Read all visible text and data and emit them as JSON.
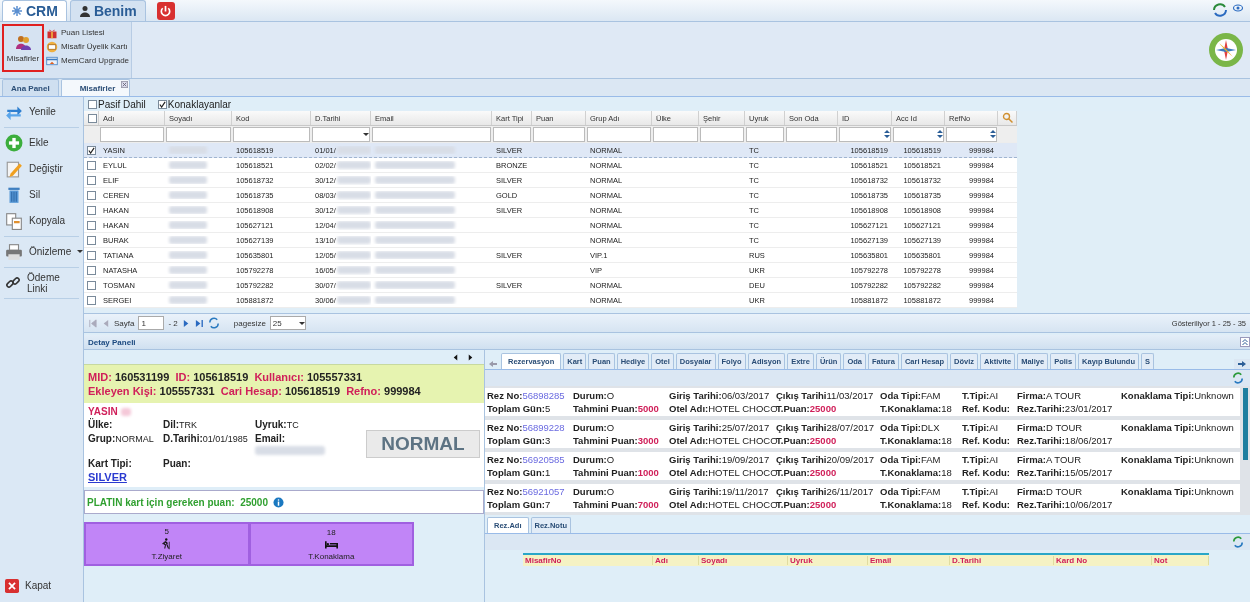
{
  "top_tabs": [
    {
      "label": "CRM",
      "selected": true
    },
    {
      "label": "Benim",
      "selected": false
    }
  ],
  "ribbon": {
    "main": {
      "label": "Misafirler",
      "selected": true
    },
    "items": [
      "Puan Listesi",
      "Misafir Üyelik Kartı",
      "MemCard Upgrade"
    ]
  },
  "doc_tabs": [
    {
      "label": "Ana Panel",
      "selected": false,
      "closable": false
    },
    {
      "label": "Misafirler",
      "selected": true,
      "closable": true
    }
  ],
  "sidebar": {
    "items": [
      {
        "label": "Yenile",
        "has_menu": false
      },
      {
        "label": "Ekle",
        "has_menu": false
      },
      {
        "label": "Değiştir",
        "has_menu": false
      },
      {
        "label": "Sil",
        "has_menu": false
      },
      {
        "label": "Kopyala",
        "has_menu": false
      },
      {
        "label": "Önizleme",
        "has_menu": true
      },
      {
        "label": "Ödeme Linki",
        "has_menu": false
      }
    ],
    "footer": "Kapat"
  },
  "filters": [
    {
      "label": "Pasif Dahil",
      "checked": false
    },
    {
      "label": "Konaklayanlar",
      "checked": true
    }
  ],
  "grid": {
    "all_selected": false,
    "columns": [
      {
        "label": "Adı",
        "kind": "text",
        "redacted": false
      },
      {
        "label": "Soyadı",
        "kind": "text",
        "redacted": true
      },
      {
        "label": "Kod",
        "kind": "text",
        "redacted": false
      },
      {
        "label": "D.Tarihi",
        "kind": "date",
        "redacted": true
      },
      {
        "label": "Email",
        "kind": "text",
        "redacted": true
      },
      {
        "label": "Kart Tipi",
        "kind": "text",
        "redacted": false
      },
      {
        "label": "Puan",
        "kind": "text",
        "redacted": false
      },
      {
        "label": "Grup Adı",
        "kind": "text",
        "redacted": false
      },
      {
        "label": "Ülke",
        "kind": "text",
        "redacted": false
      },
      {
        "label": "Şehir",
        "kind": "text",
        "redacted": false
      },
      {
        "label": "Uyruk",
        "kind": "text",
        "redacted": false
      },
      {
        "label": "Son Oda",
        "kind": "text",
        "redacted": false
      },
      {
        "label": "ID",
        "kind": "number",
        "redacted": false
      },
      {
        "label": "Acc Id",
        "kind": "number",
        "redacted": false
      },
      {
        "label": "RefNo",
        "kind": "number",
        "redacted": false
      }
    ],
    "rows": [
      {
        "selected": true,
        "name": "YASIN",
        "code": "105618519",
        "birth": "01/01/",
        "card": "SILVER",
        "group": "NORMAL",
        "nationality": "TC",
        "id": "105618519",
        "acc_id": "105618519",
        "ref_no": "999984"
      },
      {
        "selected": false,
        "name": "EYLUL",
        "code": "105618521",
        "birth": "02/02/",
        "card": "BRONZE",
        "group": "NORMAL",
        "nationality": "TC",
        "id": "105618521",
        "acc_id": "105618521",
        "ref_no": "999984"
      },
      {
        "selected": false,
        "name": "ELIF",
        "code": "105618732",
        "birth": "30/12/",
        "card": "SILVER",
        "group": "NORMAL",
        "nationality": "TC",
        "id": "105618732",
        "acc_id": "105618732",
        "ref_no": "999984"
      },
      {
        "selected": false,
        "name": "CEREN",
        "code": "105618735",
        "birth": "08/03/",
        "card": "GOLD",
        "group": "NORMAL",
        "nationality": "TC",
        "id": "105618735",
        "acc_id": "105618735",
        "ref_no": "999984"
      },
      {
        "selected": false,
        "name": "HAKAN",
        "code": "105618908",
        "birth": "30/12/",
        "card": "SILVER",
        "group": "NORMAL",
        "nationality": "TC",
        "id": "105618908",
        "acc_id": "105618908",
        "ref_no": "999984"
      },
      {
        "selected": false,
        "name": "HAKAN",
        "code": "105627121",
        "birth": "12/04/",
        "group": "NORMAL",
        "nationality": "TC",
        "id": "105627121",
        "acc_id": "105627121",
        "ref_no": "999984"
      },
      {
        "selected": false,
        "name": "BURAK",
        "code": "105627139",
        "birth": "13/10/",
        "group": "NORMAL",
        "nationality": "TC",
        "id": "105627139",
        "acc_id": "105627139",
        "ref_no": "999984"
      },
      {
        "selected": false,
        "name": "TATIANA",
        "code": "105635801",
        "birth": "12/05/",
        "card": "SILVER",
        "group": "VIP.1",
        "nationality": "RUS",
        "id": "105635801",
        "acc_id": "105635801",
        "ref_no": "999984"
      },
      {
        "selected": false,
        "name": "NATASHA",
        "code": "105792278",
        "birth": "16/05/",
        "group": "VIP",
        "nationality": "UKR",
        "id": "105792278",
        "acc_id": "105792278",
        "ref_no": "999984"
      },
      {
        "selected": false,
        "name": "TOSMAN",
        "code": "105792282",
        "birth": "30/07/",
        "card": "SILVER",
        "group": "NORMAL",
        "nationality": "DEU",
        "id": "105792282",
        "acc_id": "105792282",
        "ref_no": "999984"
      },
      {
        "selected": false,
        "name": "SERGEI",
        "code": "105881872",
        "birth": "30/06/",
        "group": "NORMAL",
        "nationality": "UKR",
        "id": "105881872",
        "acc_id": "105881872",
        "ref_no": "999984"
      }
    ]
  },
  "pager": {
    "page_label": "Sayfa",
    "page": "1",
    "page_count": "- 2",
    "size_label": "pagesize",
    "size": "25",
    "summary": "Gösteriliyor 1 - 25 - 35"
  },
  "detail": {
    "title": "Detay Paneli",
    "header": [
      {
        "label": "MID:",
        "value": "160531199"
      },
      {
        "label": "ID:",
        "value": "105618519"
      },
      {
        "label": "Kullanıcı:",
        "value": "105557331"
      },
      {
        "label": "Ekleyen Kişi:",
        "value": "105557331"
      },
      {
        "label": "Cari Hesap:",
        "value": "105618519"
      },
      {
        "label": "Refno:",
        "value": "999984"
      }
    ],
    "name": "YASIN",
    "surname_redacted": true,
    "fields": [
      {
        "label": "Ülke:",
        "kind": "text"
      },
      {
        "label": "Dil:",
        "value": "TRK",
        "kind": "text"
      },
      {
        "label": "Uyruk:",
        "value": "TC",
        "kind": "text"
      },
      {
        "label": "Grup:",
        "value": "NORMAL",
        "kind": "text"
      },
      {
        "label": "D.Tarihi:",
        "value": "01/01/1985",
        "kind": "text"
      },
      {
        "label": "Email:",
        "kind": "redacted"
      },
      {
        "label": "Kart Tipi:",
        "value": "SILVER",
        "kind": "link"
      },
      {
        "label": "Puan:",
        "kind": "text"
      }
    ],
    "badge": "NORMAL",
    "requirement": {
      "text": "PLATIN kart için gereken puan:",
      "value": "25000"
    },
    "stats": [
      {
        "value": "5",
        "label": "T.Ziyaret"
      },
      {
        "value": "18",
        "label": "T.Konaklama"
      }
    ]
  },
  "right_tabs": [
    {
      "label": "Rezervasyon",
      "selected": true
    },
    {
      "label": "Kart",
      "selected": false
    },
    {
      "label": "Puan",
      "selected": false
    },
    {
      "label": "Hediye",
      "selected": false
    },
    {
      "label": "Otel",
      "selected": false
    },
    {
      "label": "Dosyalar",
      "selected": false
    },
    {
      "label": "Folyo",
      "selected": false
    },
    {
      "label": "Adisyon",
      "selected": false
    },
    {
      "label": "Extre",
      "selected": false
    },
    {
      "label": "Ürün",
      "selected": false
    },
    {
      "label": "Oda",
      "selected": false
    },
    {
      "label": "Fatura",
      "selected": false
    },
    {
      "label": "Cari Hesap",
      "selected": false
    },
    {
      "label": "Döviz",
      "selected": false
    },
    {
      "label": "Aktivite",
      "selected": false
    },
    {
      "label": "Maliye",
      "selected": false
    },
    {
      "label": "Polis",
      "selected": false
    },
    {
      "label": "Kayıp Bulundu",
      "selected": false
    },
    {
      "label": "S",
      "selected": false
    }
  ],
  "reservations": [
    {
      "fields": [
        {
          "label": "Rez No:",
          "value": "56898285",
          "kind": "link"
        },
        {
          "label": "Durum:",
          "value": "O",
          "kind": "plain"
        },
        {
          "label": "Giriş Tarihi:",
          "value": "06/03/2017",
          "kind": "plain"
        },
        {
          "label": "Çıkış Tarihi",
          "value": "11/03/2017",
          "kind": "plain"
        },
        {
          "label": "Oda Tipi:",
          "value": "FAM",
          "kind": "plain"
        },
        {
          "label": "T.Tipi:",
          "value": "AI",
          "kind": "plain"
        },
        {
          "label": "Firma:",
          "value": "A TOUR",
          "kind": "plain"
        },
        {
          "label": "Konaklama Tipi:",
          "value": "Unknown",
          "kind": "plain"
        },
        {
          "label": "Toplam Gün:",
          "value": "5",
          "kind": "plain"
        },
        {
          "label": "Tahmini Puan:",
          "value": "5000",
          "kind": "points"
        },
        {
          "label": "Otel Adı:",
          "value": "HOTEL CHOCO",
          "kind": "plain"
        },
        {
          "label": "T.Puan:",
          "value": "25000",
          "kind": "points"
        },
        {
          "label": "T.Konaklama:",
          "value": "18",
          "kind": "plain"
        },
        {
          "label": "Ref. Kodu:",
          "kind": "plain"
        },
        {
          "label": "Rez.Tarihi:",
          "value": "23/01/2017",
          "kind": "plain"
        }
      ]
    },
    {
      "fields": [
        {
          "label": "Rez No:",
          "value": "56899228",
          "kind": "link"
        },
        {
          "label": "Durum:",
          "value": "O",
          "kind": "plain"
        },
        {
          "label": "Giriş Tarihi:",
          "value": "25/07/2017",
          "kind": "plain"
        },
        {
          "label": "Çıkış Tarihi",
          "value": "28/07/2017",
          "kind": "plain"
        },
        {
          "label": "Oda Tipi:",
          "value": "DLX",
          "kind": "plain"
        },
        {
          "label": "T.Tipi:",
          "value": "AI",
          "kind": "plain"
        },
        {
          "label": "Firma:",
          "value": "D TOUR",
          "kind": "plain"
        },
        {
          "label": "Konaklama Tipi:",
          "value": "Unknown",
          "kind": "plain"
        },
        {
          "label": "Toplam Gün:",
          "value": "3",
          "kind": "plain"
        },
        {
          "label": "Tahmini Puan:",
          "value": "3000",
          "kind": "points"
        },
        {
          "label": "Otel Adı:",
          "value": "HOTEL CHOCO",
          "kind": "plain"
        },
        {
          "label": "T.Puan:",
          "value": "25000",
          "kind": "points"
        },
        {
          "label": "T.Konaklama:",
          "value": "18",
          "kind": "plain"
        },
        {
          "label": "Ref. Kodu:",
          "kind": "plain"
        },
        {
          "label": "Rez.Tarihi:",
          "value": "18/06/2017",
          "kind": "plain"
        }
      ]
    },
    {
      "fields": [
        {
          "label": "Rez No:",
          "value": "56920585",
          "kind": "link"
        },
        {
          "label": "Durum:",
          "value": "O",
          "kind": "plain"
        },
        {
          "label": "Giriş Tarihi:",
          "value": "19/09/2017",
          "kind": "plain"
        },
        {
          "label": "Çıkış Tarihi",
          "value": "20/09/2017",
          "kind": "plain"
        },
        {
          "label": "Oda Tipi:",
          "value": "FAM",
          "kind": "plain"
        },
        {
          "label": "T.Tipi:",
          "value": "AI",
          "kind": "plain"
        },
        {
          "label": "Firma:",
          "value": "A TOUR",
          "kind": "plain"
        },
        {
          "label": "Konaklama Tipi:",
          "value": "Unknown",
          "kind": "plain"
        },
        {
          "label": "Toplam Gün:",
          "value": "1",
          "kind": "plain"
        },
        {
          "label": "Tahmini Puan:",
          "value": "1000",
          "kind": "points"
        },
        {
          "label": "Otel Adı:",
          "value": "HOTEL CHOCO",
          "kind": "plain"
        },
        {
          "label": "T.Puan:",
          "value": "25000",
          "kind": "points"
        },
        {
          "label": "T.Konaklama:",
          "value": "18",
          "kind": "plain"
        },
        {
          "label": "Ref. Kodu:",
          "kind": "plain"
        },
        {
          "label": "Rez.Tarihi:",
          "value": "15/05/2017",
          "kind": "plain"
        }
      ]
    },
    {
      "fields": [
        {
          "label": "Rez No:",
          "value": "56921057",
          "kind": "link"
        },
        {
          "label": "Durum:",
          "value": "O",
          "kind": "plain"
        },
        {
          "label": "Giriş Tarihi:",
          "value": "19/11/2017",
          "kind": "plain"
        },
        {
          "label": "Çıkış Tarihi",
          "value": "26/11/2017",
          "kind": "plain"
        },
        {
          "label": "Oda Tipi:",
          "value": "FAM",
          "kind": "plain"
        },
        {
          "label": "T.Tipi:",
          "value": "AI",
          "kind": "plain"
        },
        {
          "label": "Firma:",
          "value": "D TOUR",
          "kind": "plain"
        },
        {
          "label": "Konaklama Tipi:",
          "value": "Unknown",
          "kind": "plain"
        },
        {
          "label": "Toplam Gün:",
          "value": "7",
          "kind": "plain"
        },
        {
          "label": "Tahmini Puan:",
          "value": "7000",
          "kind": "points"
        },
        {
          "label": "Otel Adı:",
          "value": "HOTEL CHOCO",
          "kind": "plain"
        },
        {
          "label": "T.Puan:",
          "value": "25000",
          "kind": "points"
        },
        {
          "label": "T.Konaklama:",
          "value": "18",
          "kind": "plain"
        },
        {
          "label": "Ref. Kodu:",
          "kind": "plain"
        },
        {
          "label": "Rez.Tarihi:",
          "value": "10/06/2017",
          "kind": "plain"
        }
      ]
    }
  ],
  "sub_tabs": [
    {
      "label": "Rez.Adı",
      "selected": true
    },
    {
      "label": "Rez.Notu",
      "selected": false
    }
  ],
  "sub_grid": {
    "columns": [
      "MisafirNo",
      "Adı",
      "Soyadı",
      "Uyruk",
      "Email",
      "D.Tarihi",
      "Kard No",
      "Not"
    ]
  }
}
